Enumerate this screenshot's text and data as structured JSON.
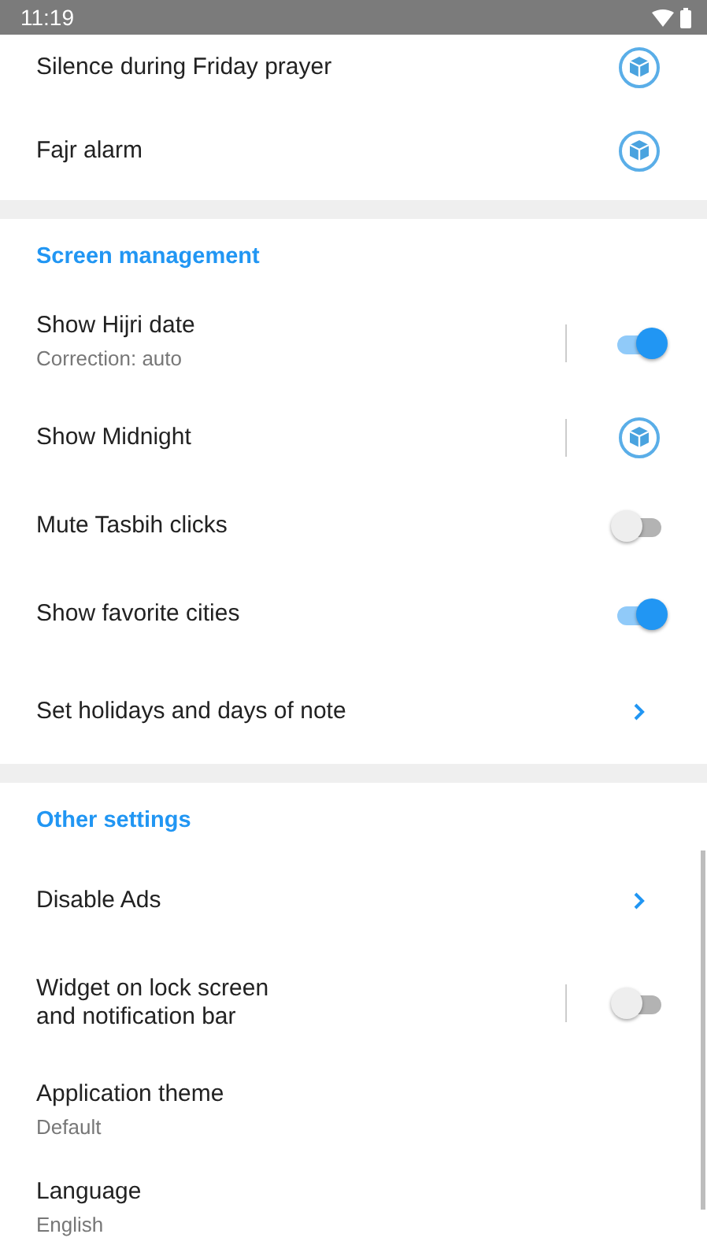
{
  "status_bar": {
    "time": "11:19"
  },
  "sections": [
    {
      "items": [
        {
          "kind": "premium",
          "title": "Silence during Friday prayer",
          "divider": false
        },
        {
          "kind": "premium",
          "title": "Fajr alarm",
          "divider": false
        }
      ]
    },
    {
      "header": "Screen management",
      "items": [
        {
          "kind": "toggle",
          "title": "Show Hijri date",
          "subtitle": "Correction: auto",
          "divider": true,
          "on": true
        },
        {
          "kind": "premium",
          "title": "Show Midnight",
          "divider": true
        },
        {
          "kind": "toggle",
          "title": "Mute Tasbih clicks",
          "divider": false,
          "on": false
        },
        {
          "kind": "toggle",
          "title": "Show favorite cities",
          "divider": false,
          "on": true
        },
        {
          "kind": "link",
          "title": "Set holidays and days of note",
          "divider": false
        }
      ]
    },
    {
      "header": "Other settings",
      "items": [
        {
          "kind": "link",
          "title": "Disable Ads",
          "divider": false
        },
        {
          "kind": "toggle",
          "title": "Widget on lock screen\nand notification bar",
          "divider": true,
          "on": false
        },
        {
          "kind": "plain",
          "title": "Application theme",
          "subtitle": "Default",
          "divider": false
        },
        {
          "kind": "plain",
          "title": "Language",
          "subtitle": "English",
          "divider": false
        }
      ]
    }
  ]
}
